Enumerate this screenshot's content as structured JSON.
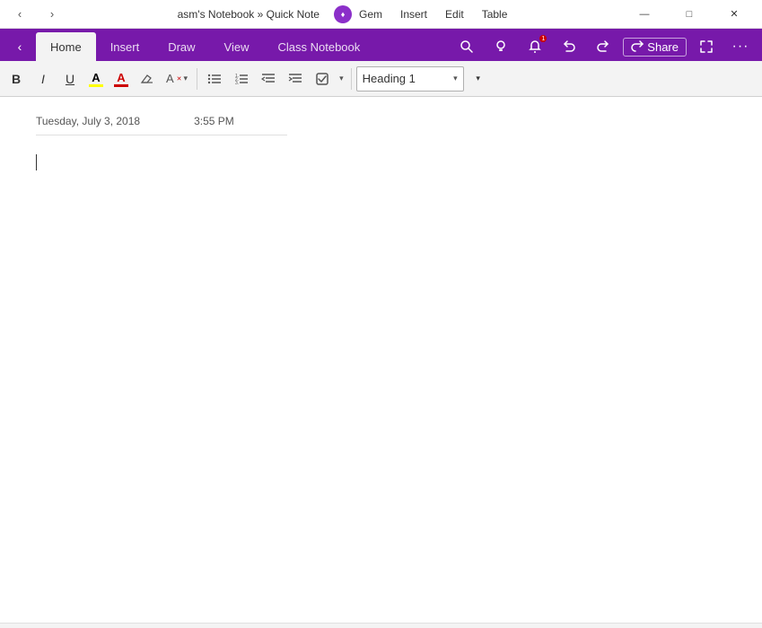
{
  "titlebar": {
    "back_arrow": "‹",
    "forward_arrow": "›",
    "title": "asm's Notebook » Quick Note",
    "gem_label": "♦",
    "menu_items": [
      "Gem",
      "Insert",
      "Edit",
      "Table"
    ],
    "minimize": "—",
    "maximize": "□",
    "close": "✕"
  },
  "ribbon": {
    "back_label": "‹",
    "tabs": [
      "Home",
      "Insert",
      "Draw",
      "View",
      "Class Notebook"
    ],
    "active_tab": "Home",
    "icons": {
      "search": "🔍",
      "bulb": "💡",
      "bell": "🔔",
      "undo": "↩",
      "redo": "↪",
      "share": "Share",
      "expand": "⤢",
      "more": "···"
    }
  },
  "toolbar": {
    "bold": "B",
    "italic": "I",
    "underline": "U",
    "highlight_color": "yellow",
    "font_color": "red",
    "eraser": "⌫",
    "format_clear": "A",
    "format_clear_arrow": "▾",
    "bullets": "≡",
    "numbering": "≣",
    "outdent": "⇤",
    "indent": "⇥",
    "todo": "☑",
    "todo_arrow": "▾",
    "style_label": "Heading 1",
    "style_arrow": "▾"
  },
  "page": {
    "date": "Tuesday, July 3, 2018",
    "time": "3:55 PM"
  }
}
